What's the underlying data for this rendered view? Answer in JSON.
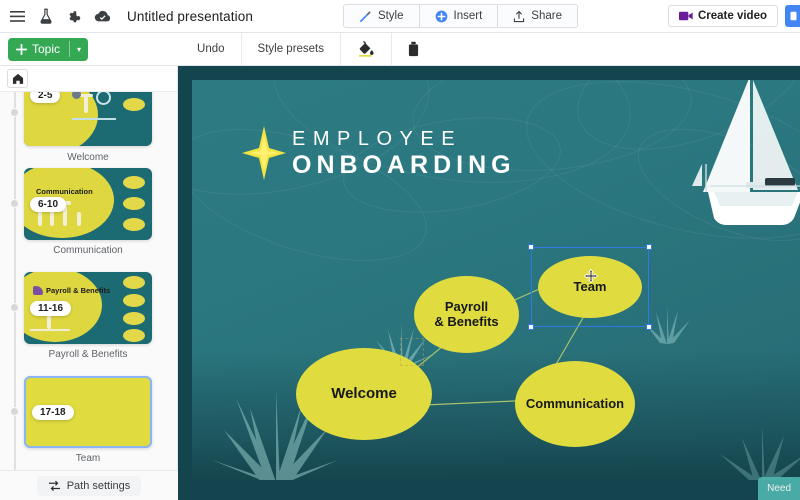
{
  "header": {
    "menu_icon": "hamburger-menu-icon",
    "labs_icon": "flask-icon",
    "settings_icon": "gear-icon",
    "cloud_icon": "cloud-saved-icon",
    "doc_title": "Untitled presentation",
    "buttons": [
      {
        "label": "Style",
        "icon": "magic-wand-icon"
      },
      {
        "label": "Insert",
        "icon": "plus-circle-icon"
      },
      {
        "label": "Share",
        "icon": "upload-icon"
      }
    ],
    "create_video": {
      "label": "Create video",
      "icon": "video-camera-icon",
      "color": "#6a1b9a"
    },
    "present_button": {
      "label": "",
      "icon": "present-icon",
      "color": "#4285f4"
    }
  },
  "subbar": {
    "topic_button": {
      "label": "Topic",
      "icon": "plus-icon",
      "caret": "▾",
      "color": "#34a853"
    },
    "tools": [
      {
        "label": "Undo",
        "icon": "undo-label"
      },
      {
        "label": "Style presets",
        "icon": "style-presets-label"
      },
      {
        "label": "",
        "icon": "paint-bucket-icon"
      },
      {
        "label": "",
        "icon": "ink-bottle-icon"
      }
    ]
  },
  "sidebar": {
    "home_icon": "home-icon",
    "items": [
      {
        "label": "Welcome",
        "badge": "2-5",
        "title": "",
        "selected": false
      },
      {
        "label": "Communication",
        "badge": "6-10",
        "title": "Communication",
        "selected": false
      },
      {
        "label": "Payroll & Benefits",
        "badge": "11-16",
        "title": "Payroll\n& Benefits",
        "selected": false
      },
      {
        "label": "Team",
        "badge": "17-18",
        "title": "",
        "selected": true
      }
    ],
    "path_settings": {
      "label": "Path settings",
      "icon": "path-settings-icon"
    }
  },
  "canvas": {
    "slide_title_line1": "EMPLOYEE",
    "slide_title_line2": "ONBOARDING",
    "star_icon": "four-point-star-icon",
    "boat_icon": "sailboat-icon",
    "background_color": "#2b7880",
    "node_color": "#e0db3f",
    "nodes": [
      {
        "id": "payroll",
        "label": "Payroll\n& Benefits",
        "selected": false
      },
      {
        "id": "team",
        "label": "Team",
        "selected": true
      },
      {
        "id": "welcome",
        "label": "Welcome",
        "selected": false
      },
      {
        "id": "communication",
        "label": "Communication",
        "selected": false
      }
    ],
    "need_help": "Need"
  }
}
